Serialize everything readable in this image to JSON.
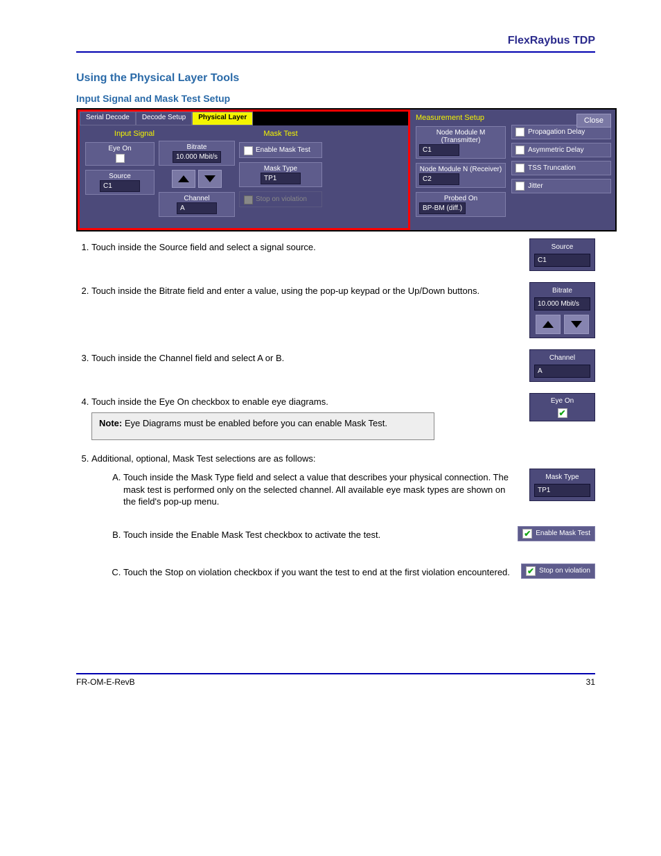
{
  "header": {
    "brand": "FlexRaybus TDP"
  },
  "titles": {
    "section": "Using the Physical Layer Tools",
    "input_signal_mask": "Input Signal and Mask Test Setup"
  },
  "dialog": {
    "tabs": [
      "Serial Decode",
      "Decode Setup",
      "Physical Layer"
    ],
    "active_tab_index": 2,
    "close": "Close",
    "groups": {
      "input_signal": "Input Signal",
      "mask_test": "Mask Test",
      "measurement_setup": "Measurement Setup"
    },
    "input": {
      "eye_on_label": "Eye On",
      "source_label": "Source",
      "source_value": "C1",
      "bitrate_label": "Bitrate",
      "bitrate_value": "10.000 Mbit/s",
      "channel_label": "Channel",
      "channel_value": "A"
    },
    "mask": {
      "enable_label": "Enable Mask Test",
      "mask_type_label": "Mask Type",
      "mask_type_value": "TP1",
      "stop_label": "Stop on violation"
    },
    "measure": {
      "node_m_label": "Node Module M (Transmitter)",
      "node_m_value": "C1",
      "node_n_label": "Node Module N (Receiver)",
      "node_n_value": "C2",
      "probed_label": "Probed On",
      "probed_value": "BP-BM (diff.)",
      "chks": [
        "Propagation Delay",
        "Asymmetric Delay",
        "TSS Truncation",
        "Jitter"
      ]
    }
  },
  "steps": {
    "1": "Touch inside the Source field and select a signal source.",
    "2": "Touch inside the Bitrate field and enter a value, using the pop-up keypad or the Up/Down buttons.",
    "3": "Touch inside the Channel field and select A or B.",
    "4a": "Touch inside the Eye On checkbox to enable eye diagrams.",
    "4b": "Eye Diagrams must be enabled before you can enable Mask Test.",
    "note_label": "Note:",
    "5_intro": "Additional, optional, Mask Test selections are as follows:",
    "5A": "Touch inside the Mask Type field and select a value that describes your physical connection. The mask test is performed only on the selected channel. All available eye mask types are shown on the field's pop-up menu.",
    "5B": "Touch inside the Enable Mask Test checkbox to activate the test.",
    "5C": "Touch the Stop on violation checkbox if you want the test to end at the first violation encountered."
  },
  "thumbs": {
    "source": {
      "label": "Source",
      "value": "C1"
    },
    "bitrate": {
      "label": "Bitrate",
      "value": "10.000 Mbit/s"
    },
    "channel": {
      "label": "Channel",
      "value": "A"
    },
    "eye_on": {
      "label": "Eye On"
    },
    "mask_type": {
      "label": "Mask Type",
      "value": "TP1"
    },
    "enable_mask": {
      "label": "Enable Mask Test"
    },
    "stop": {
      "label": "Stop on violation"
    }
  },
  "footer": {
    "left": "FR-OM-E-RevB",
    "right": "31"
  }
}
